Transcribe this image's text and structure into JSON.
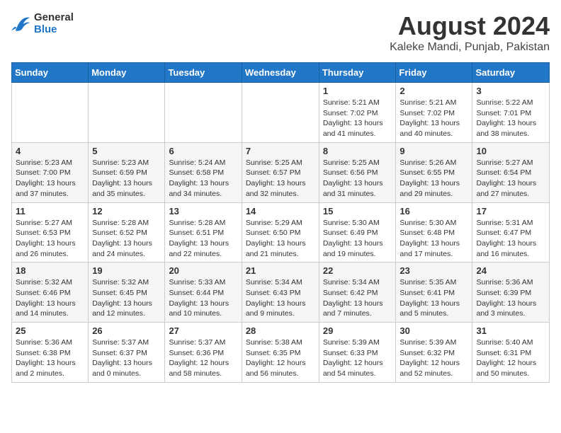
{
  "header": {
    "logo_line1": "General",
    "logo_line2": "Blue",
    "main_title": "August 2024",
    "subtitle": "Kaleke Mandi, Punjab, Pakistan"
  },
  "weekdays": [
    "Sunday",
    "Monday",
    "Tuesday",
    "Wednesday",
    "Thursday",
    "Friday",
    "Saturday"
  ],
  "weeks": [
    [
      {
        "day": "",
        "info": ""
      },
      {
        "day": "",
        "info": ""
      },
      {
        "day": "",
        "info": ""
      },
      {
        "day": "",
        "info": ""
      },
      {
        "day": "1",
        "info": "Sunrise: 5:21 AM\nSunset: 7:02 PM\nDaylight: 13 hours\nand 41 minutes."
      },
      {
        "day": "2",
        "info": "Sunrise: 5:21 AM\nSunset: 7:02 PM\nDaylight: 13 hours\nand 40 minutes."
      },
      {
        "day": "3",
        "info": "Sunrise: 5:22 AM\nSunset: 7:01 PM\nDaylight: 13 hours\nand 38 minutes."
      }
    ],
    [
      {
        "day": "4",
        "info": "Sunrise: 5:23 AM\nSunset: 7:00 PM\nDaylight: 13 hours\nand 37 minutes."
      },
      {
        "day": "5",
        "info": "Sunrise: 5:23 AM\nSunset: 6:59 PM\nDaylight: 13 hours\nand 35 minutes."
      },
      {
        "day": "6",
        "info": "Sunrise: 5:24 AM\nSunset: 6:58 PM\nDaylight: 13 hours\nand 34 minutes."
      },
      {
        "day": "7",
        "info": "Sunrise: 5:25 AM\nSunset: 6:57 PM\nDaylight: 13 hours\nand 32 minutes."
      },
      {
        "day": "8",
        "info": "Sunrise: 5:25 AM\nSunset: 6:56 PM\nDaylight: 13 hours\nand 31 minutes."
      },
      {
        "day": "9",
        "info": "Sunrise: 5:26 AM\nSunset: 6:55 PM\nDaylight: 13 hours\nand 29 minutes."
      },
      {
        "day": "10",
        "info": "Sunrise: 5:27 AM\nSunset: 6:54 PM\nDaylight: 13 hours\nand 27 minutes."
      }
    ],
    [
      {
        "day": "11",
        "info": "Sunrise: 5:27 AM\nSunset: 6:53 PM\nDaylight: 13 hours\nand 26 minutes."
      },
      {
        "day": "12",
        "info": "Sunrise: 5:28 AM\nSunset: 6:52 PM\nDaylight: 13 hours\nand 24 minutes."
      },
      {
        "day": "13",
        "info": "Sunrise: 5:28 AM\nSunset: 6:51 PM\nDaylight: 13 hours\nand 22 minutes."
      },
      {
        "day": "14",
        "info": "Sunrise: 5:29 AM\nSunset: 6:50 PM\nDaylight: 13 hours\nand 21 minutes."
      },
      {
        "day": "15",
        "info": "Sunrise: 5:30 AM\nSunset: 6:49 PM\nDaylight: 13 hours\nand 19 minutes."
      },
      {
        "day": "16",
        "info": "Sunrise: 5:30 AM\nSunset: 6:48 PM\nDaylight: 13 hours\nand 17 minutes."
      },
      {
        "day": "17",
        "info": "Sunrise: 5:31 AM\nSunset: 6:47 PM\nDaylight: 13 hours\nand 16 minutes."
      }
    ],
    [
      {
        "day": "18",
        "info": "Sunrise: 5:32 AM\nSunset: 6:46 PM\nDaylight: 13 hours\nand 14 minutes."
      },
      {
        "day": "19",
        "info": "Sunrise: 5:32 AM\nSunset: 6:45 PM\nDaylight: 13 hours\nand 12 minutes."
      },
      {
        "day": "20",
        "info": "Sunrise: 5:33 AM\nSunset: 6:44 PM\nDaylight: 13 hours\nand 10 minutes."
      },
      {
        "day": "21",
        "info": "Sunrise: 5:34 AM\nSunset: 6:43 PM\nDaylight: 13 hours\nand 9 minutes."
      },
      {
        "day": "22",
        "info": "Sunrise: 5:34 AM\nSunset: 6:42 PM\nDaylight: 13 hours\nand 7 minutes."
      },
      {
        "day": "23",
        "info": "Sunrise: 5:35 AM\nSunset: 6:41 PM\nDaylight: 13 hours\nand 5 minutes."
      },
      {
        "day": "24",
        "info": "Sunrise: 5:36 AM\nSunset: 6:39 PM\nDaylight: 13 hours\nand 3 minutes."
      }
    ],
    [
      {
        "day": "25",
        "info": "Sunrise: 5:36 AM\nSunset: 6:38 PM\nDaylight: 13 hours\nand 2 minutes."
      },
      {
        "day": "26",
        "info": "Sunrise: 5:37 AM\nSunset: 6:37 PM\nDaylight: 13 hours\nand 0 minutes."
      },
      {
        "day": "27",
        "info": "Sunrise: 5:37 AM\nSunset: 6:36 PM\nDaylight: 12 hours\nand 58 minutes."
      },
      {
        "day": "28",
        "info": "Sunrise: 5:38 AM\nSunset: 6:35 PM\nDaylight: 12 hours\nand 56 minutes."
      },
      {
        "day": "29",
        "info": "Sunrise: 5:39 AM\nSunset: 6:33 PM\nDaylight: 12 hours\nand 54 minutes."
      },
      {
        "day": "30",
        "info": "Sunrise: 5:39 AM\nSunset: 6:32 PM\nDaylight: 12 hours\nand 52 minutes."
      },
      {
        "day": "31",
        "info": "Sunrise: 5:40 AM\nSunset: 6:31 PM\nDaylight: 12 hours\nand 50 minutes."
      }
    ]
  ]
}
